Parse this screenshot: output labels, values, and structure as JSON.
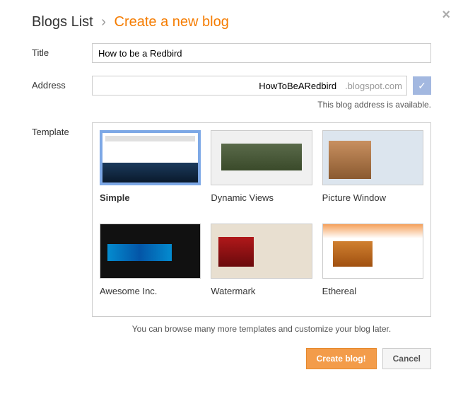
{
  "breadcrumb": {
    "root": "Blogs List",
    "sep": "›",
    "current": "Create a new blog"
  },
  "labels": {
    "title": "Title",
    "address": "Address",
    "template": "Template"
  },
  "title_value": "How to be a Redbird",
  "address": {
    "value": "HowToBeARedbird",
    "suffix": ".blogspot.com",
    "status": "This blog address is available."
  },
  "templates": [
    {
      "name": "Simple",
      "thumb_class": "th-simple",
      "selected": true
    },
    {
      "name": "Dynamic Views",
      "thumb_class": "th-dynamic",
      "selected": false
    },
    {
      "name": "Picture Window",
      "thumb_class": "th-picture",
      "selected": false
    },
    {
      "name": "Awesome Inc.",
      "thumb_class": "th-awesome",
      "selected": false
    },
    {
      "name": "Watermark",
      "thumb_class": "th-watermark",
      "selected": false
    },
    {
      "name": "Ethereal",
      "thumb_class": "th-ethereal",
      "selected": false
    }
  ],
  "hint": "You can browse many more templates and customize your blog later.",
  "buttons": {
    "create": "Create blog!",
    "cancel": "Cancel"
  }
}
